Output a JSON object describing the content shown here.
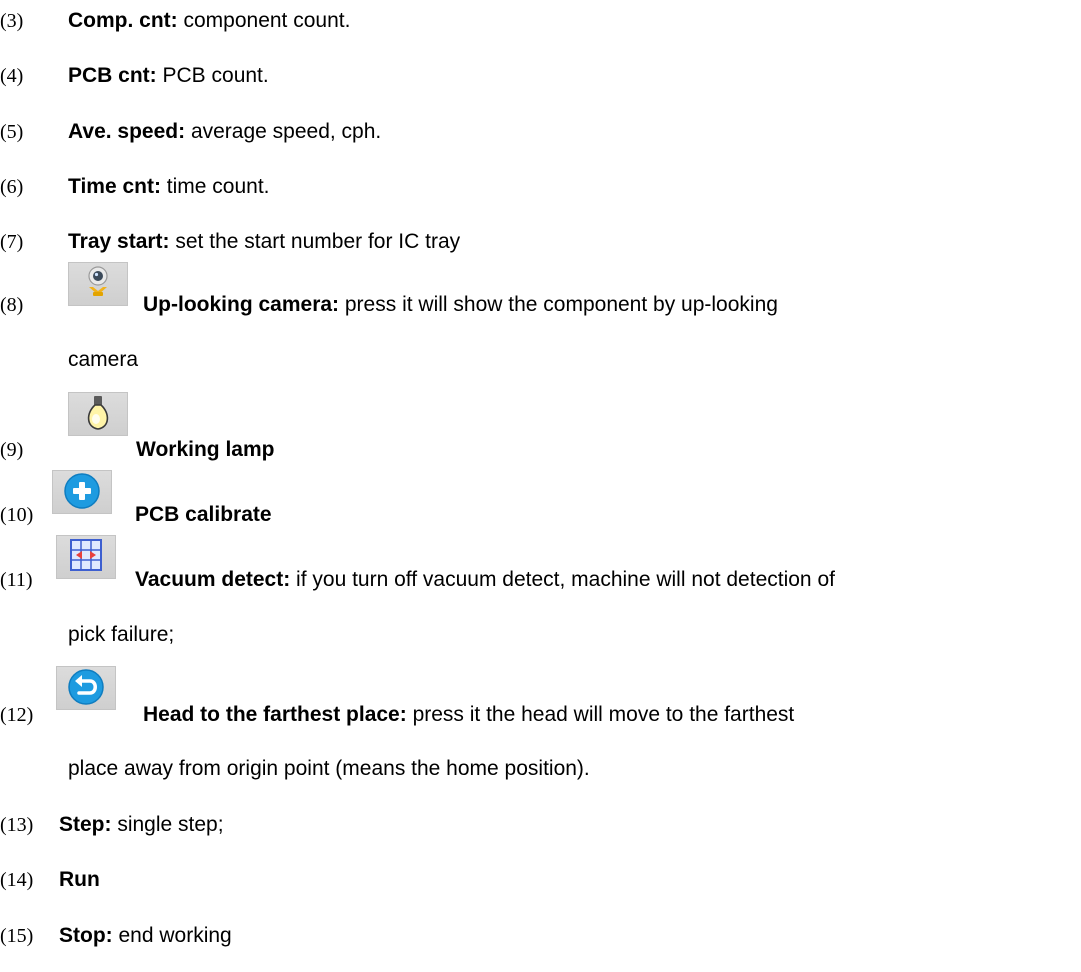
{
  "items": [
    {
      "num": "(3)",
      "term": "Comp. cnt:",
      "desc": " component count."
    },
    {
      "num": "(4)",
      "term": "PCB cnt:",
      "desc": " PCB count."
    },
    {
      "num": "(5)",
      "term": "Ave. speed:",
      "desc": " average speed, cph."
    },
    {
      "num": "(6)",
      "term": "Time cnt:",
      "desc": " time count."
    },
    {
      "num": "(7)",
      "term": "Tray start:",
      "desc": " set the start number for IC tray"
    },
    {
      "num": "(8)",
      "term": "Up-looking camera:",
      "desc": " press it will show the component by up-looking",
      "cont": "camera",
      "icon": "webcam-icon"
    },
    {
      "num": "(9)",
      "term": "Working lamp",
      "desc": "",
      "icon": "light-bulb-icon"
    },
    {
      "num": "(10)",
      "term": "PCB calibrate",
      "desc": "",
      "icon": "plus-circle-icon"
    },
    {
      "num": "(11)",
      "term": "Vacuum detect:",
      "desc": " if you turn off vacuum detect, machine will not detection of",
      "cont": "pick failure;",
      "icon": "vacuum-detect-icon"
    },
    {
      "num": "(12)",
      "term": "Head to the farthest place:",
      "desc": " press it the head will move to the farthest",
      "cont": "place away from origin point (means the home position).",
      "icon": "return-arrow-icon"
    },
    {
      "num": "(13)",
      "term": "Step:",
      "desc": " single step;"
    },
    {
      "num": "(14)",
      "term": "Run",
      "desc": ""
    },
    {
      "num": "(15)",
      "term": "Stop:",
      "desc": " end working"
    }
  ]
}
